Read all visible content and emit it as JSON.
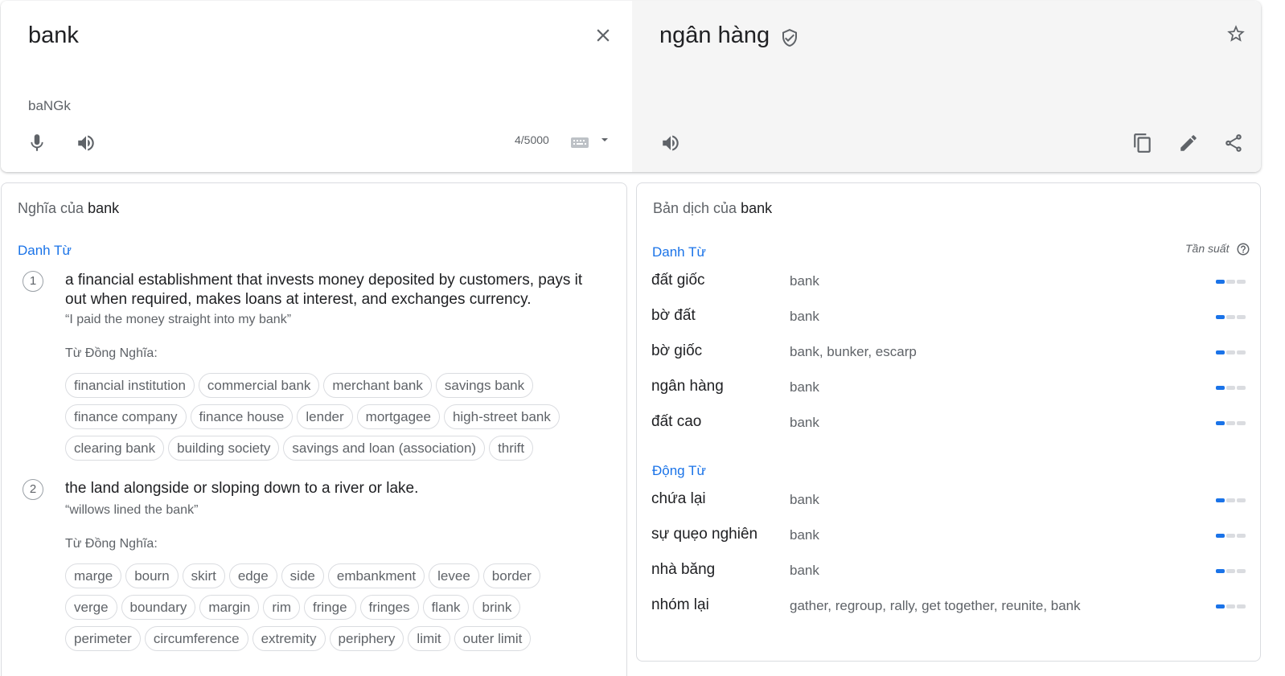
{
  "source": {
    "text": "bank",
    "transliteration": "baNGk",
    "char_count": "4/5000"
  },
  "target": {
    "text": "ngân hàng"
  },
  "definitions": {
    "title_prefix": "Nghĩa của",
    "title_word": "bank",
    "pos": "Danh Từ",
    "synonyms_label": "Từ Đồng Nghĩa:",
    "items": [
      {
        "num": "1",
        "text": "a financial establishment that invests money deposited by customers, pays it out when required, makes loans at interest, and exchanges currency.",
        "example": "“I paid the money straight into my bank”",
        "synonym_rows": [
          [
            "financial institution",
            "commercial bank",
            "merchant bank",
            "savings bank"
          ],
          [
            "finance company",
            "finance house",
            "lender",
            "mortgagee",
            "high-street bank"
          ],
          [
            "clearing bank",
            "building society",
            "savings and loan (association)",
            "thrift"
          ]
        ]
      },
      {
        "num": "2",
        "text": "the land alongside or sloping down to a river or lake.",
        "example": "“willows lined the bank”",
        "synonym_rows": [
          [
            "marge",
            "bourn",
            "skirt",
            "edge",
            "side",
            "embankment",
            "levee",
            "border"
          ],
          [
            "verge",
            "boundary",
            "margin",
            "rim",
            "fringe",
            "fringes",
            "flank",
            "brink"
          ],
          [
            "perimeter",
            "circumference",
            "extremity",
            "periphery",
            "limit",
            "outer limit"
          ]
        ]
      }
    ]
  },
  "translations": {
    "title_prefix": "Bản dịch của",
    "title_word": "bank",
    "frequency_label": "Tần suất",
    "groups": [
      {
        "pos": "Danh Từ",
        "rows": [
          {
            "word": "đất giốc",
            "back": "bank",
            "freq": 1
          },
          {
            "word": "bờ đất",
            "back": "bank",
            "freq": 1
          },
          {
            "word": "bờ giốc",
            "back": "bank, bunker, escarp",
            "freq": 1
          },
          {
            "word": "ngân hàng",
            "back": "bank",
            "freq": 1
          },
          {
            "word": "đất cao",
            "back": "bank",
            "freq": 1
          }
        ]
      },
      {
        "pos": "Động Từ",
        "rows": [
          {
            "word": "chứa lại",
            "back": "bank",
            "freq": 1
          },
          {
            "word": "sự quẹo nghiên",
            "back": "bank",
            "freq": 1
          },
          {
            "word": "nhà băng",
            "back": "bank",
            "freq": 1
          },
          {
            "word": "nhóm lại",
            "back": "gather, regroup, rally, get together, reunite, bank",
            "freq": 1
          }
        ]
      }
    ]
  },
  "colors": {
    "accent": "#1a73e8",
    "muted_text": "#5f6368",
    "target_panel_bg": "#f5f5f5"
  }
}
